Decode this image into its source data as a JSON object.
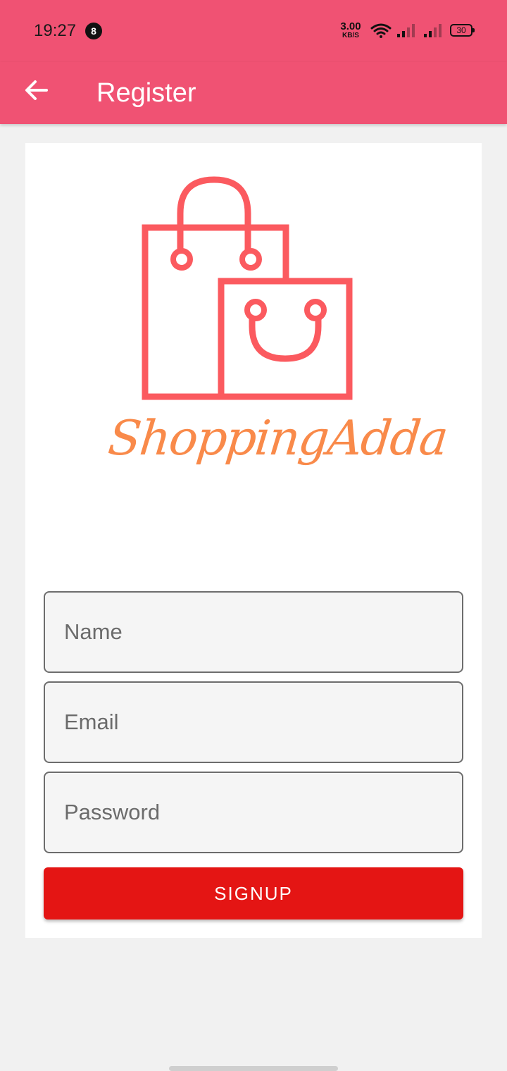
{
  "status_bar": {
    "time": "19:27",
    "notification_count": "8",
    "net_speed_value": "3.00",
    "net_speed_unit": "KB/S",
    "battery": "30",
    "icons": [
      "wifi-icon",
      "signal-icon",
      "signal-icon",
      "battery-icon"
    ]
  },
  "app_bar": {
    "title": "Register",
    "back_icon": "arrow-left-icon"
  },
  "logo": {
    "text": "ShoppingAdda",
    "icon": "shopping-bags-icon",
    "colors": {
      "bags": "#fb5a5f",
      "text": "#f98a4a"
    }
  },
  "form": {
    "name_placeholder": "Name",
    "email_placeholder": "Email",
    "password_placeholder": "Password",
    "submit_label": "SIGNUP"
  },
  "colors": {
    "primary": "#f05273",
    "accent_button": "#e41514",
    "background": "#f1f1f1"
  }
}
